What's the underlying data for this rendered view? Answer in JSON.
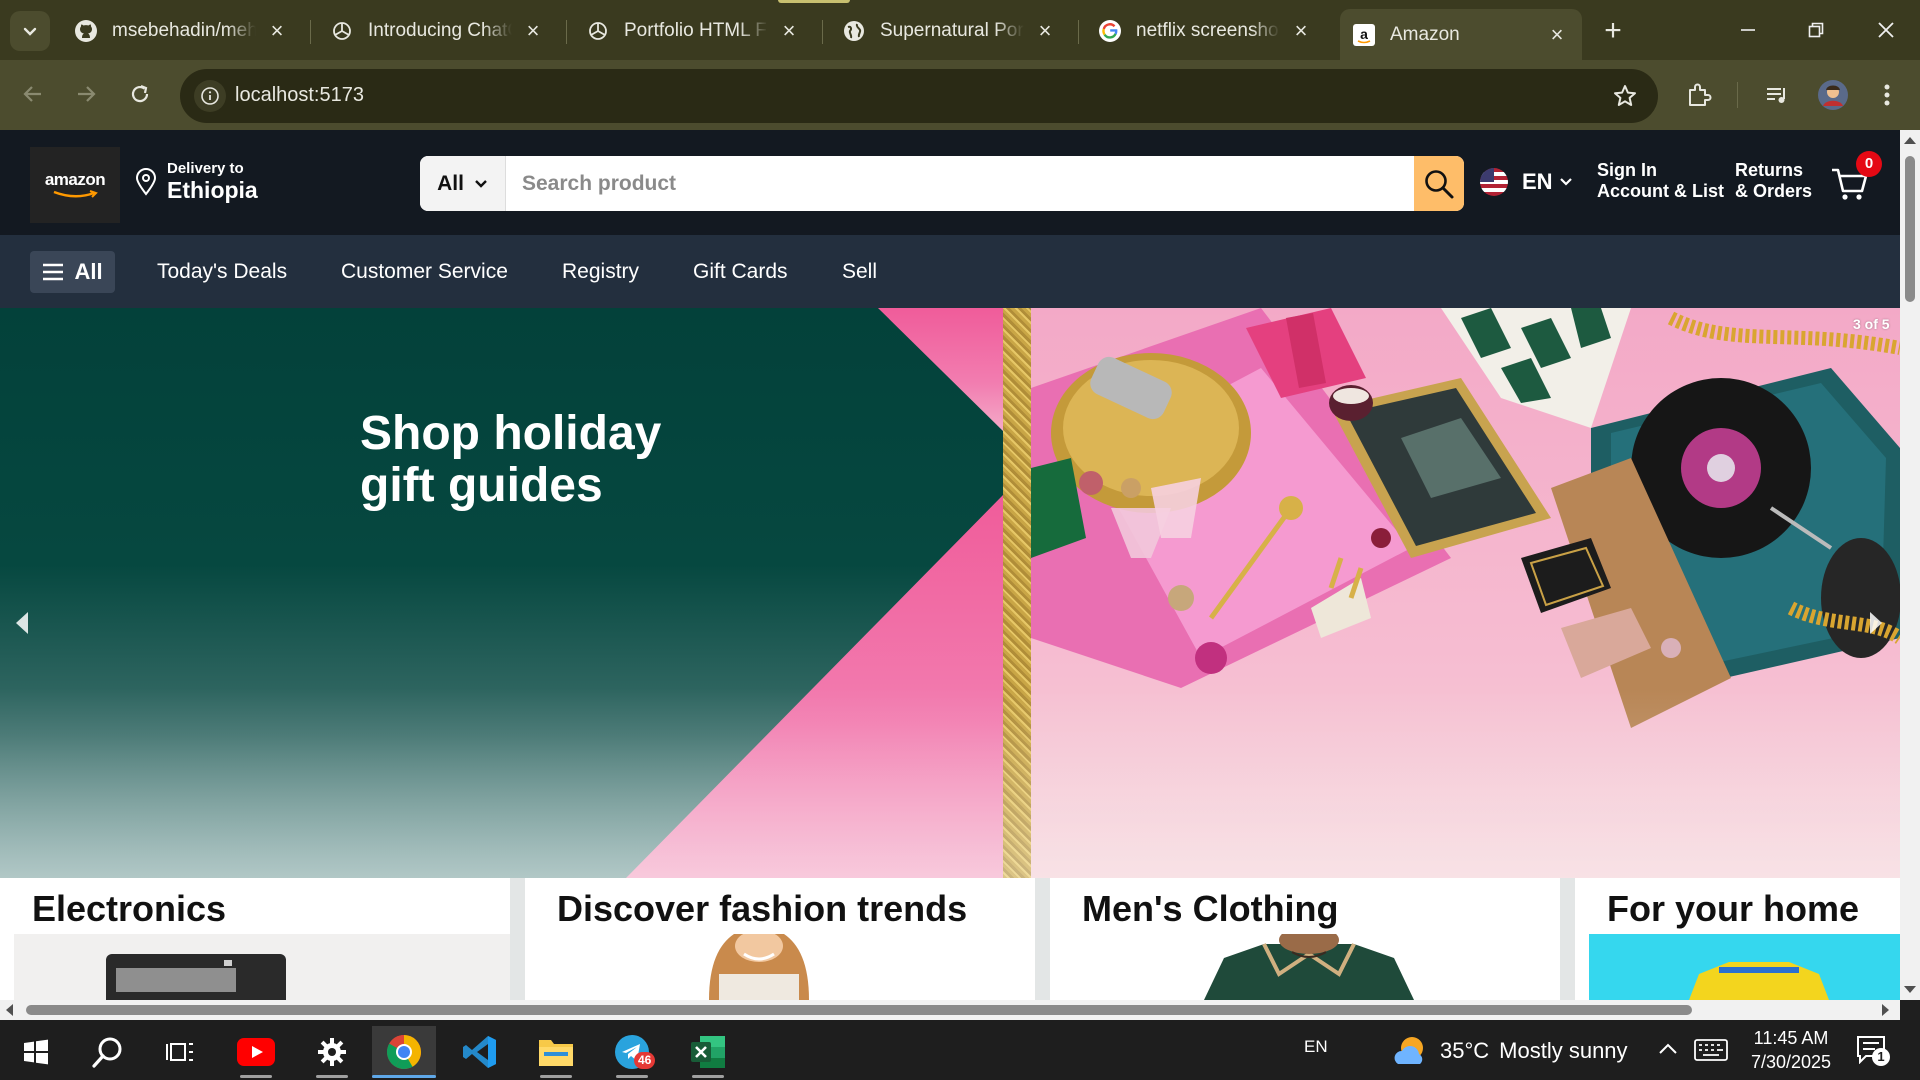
{
  "browser": {
    "tabs": [
      {
        "title": "msebehadin/meha",
        "icon": "github-icon"
      },
      {
        "title": "Introducing ChatG",
        "icon": "openai-icon"
      },
      {
        "title": "Portfolio HTML Fix",
        "icon": "openai-icon"
      },
      {
        "title": "Supernatural Portf",
        "icon": "globe-icon"
      },
      {
        "title": "netflix screenshot",
        "icon": "google-icon"
      },
      {
        "title": "Amazon",
        "icon": "amazon-icon",
        "active": true
      }
    ],
    "url": "localhost:5173"
  },
  "amazon": {
    "logo_text": "amazon",
    "delivery_label": "Delivery to",
    "delivery_country": "Ethiopia",
    "search": {
      "category": "All",
      "placeholder": "Search product"
    },
    "language": "EN",
    "account": {
      "line1": "Sign In",
      "line2": "Account & List"
    },
    "orders": {
      "line1": "Returns",
      "line2": "& Orders"
    },
    "cart_count": "0",
    "nav": {
      "all_label": "All",
      "links": [
        "Today's Deals",
        "Customer Service",
        "Registry",
        "Gift Cards",
        "Sell"
      ]
    },
    "hero": {
      "title_line1": "Shop holiday",
      "title_line2": "gift guides",
      "counter": "3 of 5"
    },
    "cards": [
      "Electronics",
      "Discover fashion trends",
      "Men's Clothing",
      "For your home"
    ]
  },
  "taskbar": {
    "apps": [
      "windows-start-icon",
      "search-icon",
      "task-view-icon",
      "youtube-icon",
      "settings-icon",
      "chrome-icon",
      "vscode-icon",
      "file-explorer-icon",
      "telegram-icon",
      "excel-icon"
    ],
    "telegram_badge": "46",
    "input_lang": "EN",
    "weather": {
      "temp": "35°C",
      "condition": "Mostly sunny"
    },
    "time": "11:45 AM",
    "date": "7/30/2025",
    "notifications": "1"
  },
  "colors": {
    "chrome_frame": "#3a3a1f",
    "chrome_toolbar": "#4c4c2e",
    "amazon_header": "#131921",
    "amazon_nav": "#232f3e",
    "search_button": "#febd69",
    "cart_badge": "#e50914"
  }
}
